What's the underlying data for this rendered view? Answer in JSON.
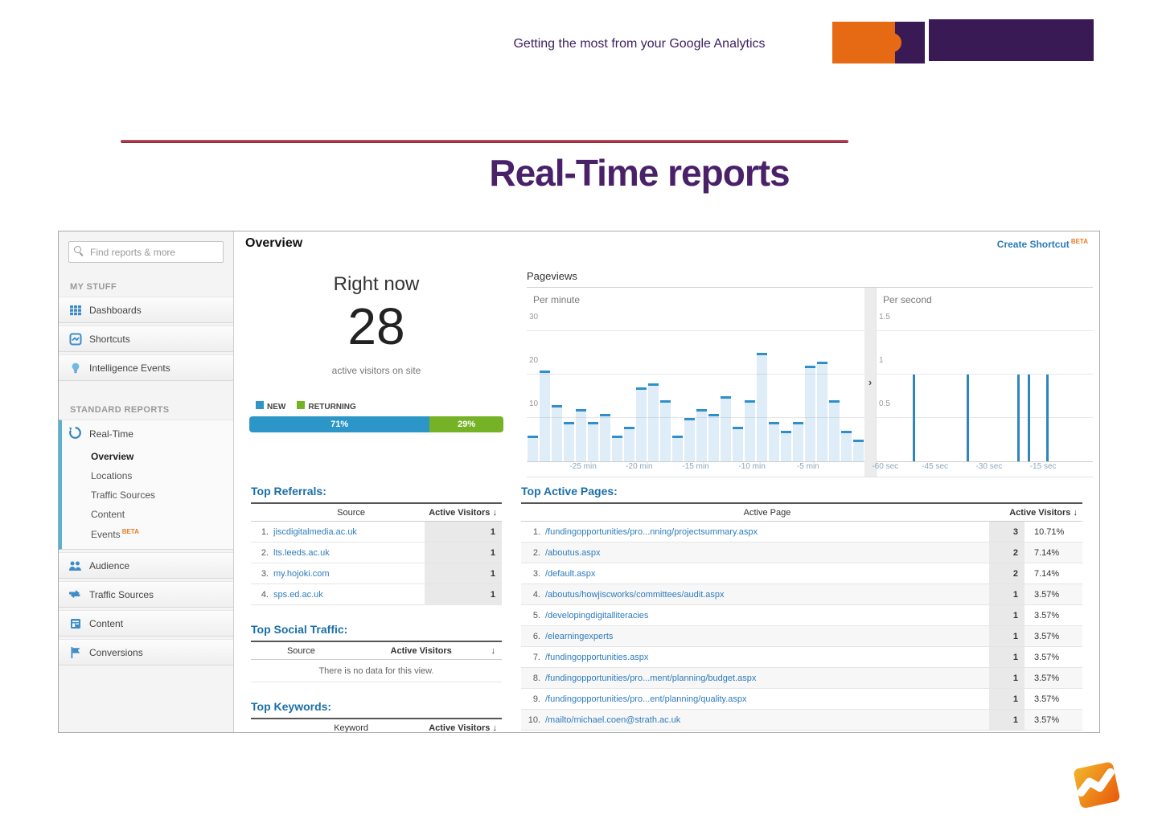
{
  "slide": {
    "header_title": "Getting the most from your Google Analytics",
    "title": "Real-Time reports",
    "colors": {
      "purple": "#4a2169",
      "orange": "#e66a14",
      "red_line": "#8e2233"
    }
  },
  "ga": {
    "sidebar": {
      "search_placeholder": "Find reports & more",
      "my_stuff_label": "MY STUFF",
      "my_stuff_items": [
        {
          "label": "Dashboards",
          "icon": "dashboards-icon"
        },
        {
          "label": "Shortcuts",
          "icon": "shortcuts-icon"
        },
        {
          "label": "Intelligence Events",
          "icon": "intelligence-events-icon"
        }
      ],
      "standard_reports_label": "STANDARD REPORTS",
      "realtime": {
        "label": "Real-Time",
        "icon": "realtime-icon",
        "sub_items": [
          {
            "label": "Overview",
            "active": true
          },
          {
            "label": "Locations",
            "active": false
          },
          {
            "label": "Traffic Sources",
            "active": false
          },
          {
            "label": "Content",
            "active": false
          },
          {
            "label": "Events",
            "active": false,
            "badge": "BETA"
          }
        ]
      },
      "report_items": [
        {
          "label": "Audience",
          "icon": "audience-icon"
        },
        {
          "label": "Traffic Sources",
          "icon": "traffic-sources-icon"
        },
        {
          "label": "Content",
          "icon": "content-icon"
        },
        {
          "label": "Conversions",
          "icon": "conversions-icon"
        }
      ]
    },
    "main": {
      "page_title": "Overview",
      "create_shortcut": "Create Shortcut",
      "beta": "BETA",
      "chevron": "›",
      "pageviews_title": "Pageviews",
      "right_now": {
        "label": "Right now",
        "count": "28",
        "caption": "active visitors on site",
        "new_label": "NEW",
        "returning_label": "RETURNING",
        "new_pct": "71%",
        "returning_pct": "29%",
        "new_color": "#2d96c8",
        "returning_color": "#76b226"
      }
    },
    "tables": {
      "sort_arrow": "↓",
      "top_referrals": {
        "title": "Top Referrals:",
        "col_source": "Source",
        "col_visitors": "Active Visitors",
        "rows": [
          {
            "n": "1.",
            "source": "jiscdigitalmedia.ac.uk",
            "visitors": "1"
          },
          {
            "n": "2.",
            "source": "lts.leeds.ac.uk",
            "visitors": "1"
          },
          {
            "n": "3.",
            "source": "my.hojoki.com",
            "visitors": "1"
          },
          {
            "n": "4.",
            "source": "sps.ed.ac.uk",
            "visitors": "1"
          }
        ]
      },
      "top_social": {
        "title": "Top Social Traffic:",
        "col_source": "Source",
        "col_visitors": "Active Visitors",
        "empty": "There is no data for this view."
      },
      "top_keywords": {
        "title": "Top Keywords:",
        "col_keyword": "Keyword",
        "col_visitors": "Active Visitors"
      },
      "top_active_pages": {
        "title": "Top Active Pages:",
        "col_page": "Active Page",
        "col_visitors": "Active Visitors",
        "rows": [
          {
            "n": "1.",
            "page": "/fundingopportunities/pro...nning/projectsummary.aspx",
            "visitors": "3",
            "pct": "10.71%"
          },
          {
            "n": "2.",
            "page": "/aboutus.aspx",
            "visitors": "2",
            "pct": "7.14%"
          },
          {
            "n": "3.",
            "page": "/default.aspx",
            "visitors": "2",
            "pct": "7.14%"
          },
          {
            "n": "4.",
            "page": "/aboutus/howjiscworks/committees/audit.aspx",
            "visitors": "1",
            "pct": "3.57%"
          },
          {
            "n": "5.",
            "page": "/developingdigitalliteracies",
            "visitors": "1",
            "pct": "3.57%"
          },
          {
            "n": "6.",
            "page": "/elearningexperts",
            "visitors": "1",
            "pct": "3.57%"
          },
          {
            "n": "7.",
            "page": "/fundingopportunities.aspx",
            "visitors": "1",
            "pct": "3.57%"
          },
          {
            "n": "8.",
            "page": "/fundingopportunities/pro...ment/planning/budget.aspx",
            "visitors": "1",
            "pct": "3.57%"
          },
          {
            "n": "9.",
            "page": "/fundingopportunities/pro...ent/planning/quality.aspx",
            "visitors": "1",
            "pct": "3.57%"
          },
          {
            "n": "10.",
            "page": "/mailto/michael.coen@strath.ac.uk",
            "visitors": "1",
            "pct": "3.57%"
          }
        ]
      }
    }
  },
  "chart_data": [
    {
      "type": "bar",
      "title": "Pageviews",
      "subtitle": "Per minute",
      "values": [
        6,
        21,
        13,
        9,
        12,
        9,
        11,
        6,
        8,
        17,
        18,
        14,
        6,
        10,
        12,
        11,
        15,
        8,
        14,
        25,
        9,
        7,
        9,
        22,
        23,
        14,
        7,
        5
      ],
      "ylim": [
        0,
        30
      ],
      "yticks": [
        10,
        20,
        30
      ],
      "xtick_labels": [
        "-25 min",
        "-20 min",
        "-15 min",
        "-10 min",
        "-5 min"
      ],
      "xtick_pos_pct": [
        16.7,
        33.3,
        50,
        66.7,
        83.3
      ],
      "bar_cap_color": "#2f8fcb",
      "bar_fill_color": "rgba(49,143,203,0.16)",
      "grid": true
    },
    {
      "type": "bar",
      "subtitle": "Per second",
      "x": [
        -50,
        -35,
        -21,
        -18,
        -13
      ],
      "values": [
        1,
        1,
        1,
        1,
        1
      ],
      "xrange": [
        -60,
        0
      ],
      "ylim": [
        0,
        1.5
      ],
      "yticks": [
        0.5,
        1,
        1.5
      ],
      "xtick_labels": [
        "-60 sec",
        "-45 sec",
        "-30 sec",
        "-15 sec"
      ],
      "xtick_pos_pct": [
        4,
        27,
        52,
        77
      ],
      "bar_cap_color": "#2e86ba",
      "grid": true
    }
  ]
}
